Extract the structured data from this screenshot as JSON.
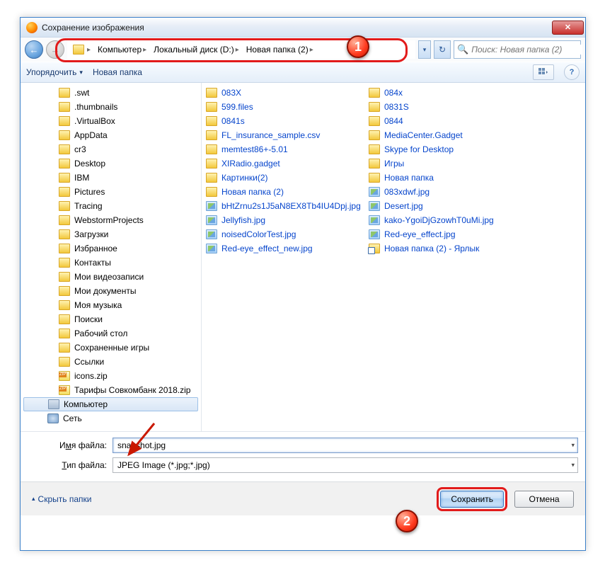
{
  "window": {
    "title": "Сохранение изображения"
  },
  "nav": {
    "breadcrumb": [
      "Компьютер",
      "Локальный диск (D:)",
      "Новая папка (2)"
    ],
    "search_placeholder": "Поиск: Новая папка (2)"
  },
  "toolbar": {
    "organize": "Упорядочить",
    "new_folder": "Новая папка"
  },
  "tree": [
    {
      "label": ".swt",
      "icon": "fld"
    },
    {
      "label": ".thumbnails",
      "icon": "fld"
    },
    {
      "label": ".VirtualBox",
      "icon": "fld"
    },
    {
      "label": "AppData",
      "icon": "fld"
    },
    {
      "label": "cr3",
      "icon": "fld"
    },
    {
      "label": "Desktop",
      "icon": "fld"
    },
    {
      "label": "IBM",
      "icon": "fld"
    },
    {
      "label": "Pictures",
      "icon": "fld"
    },
    {
      "label": "Tracing",
      "icon": "fld"
    },
    {
      "label": "WebstormProjects",
      "icon": "fld"
    },
    {
      "label": "Загрузки",
      "icon": "fld"
    },
    {
      "label": "Избранное",
      "icon": "fld"
    },
    {
      "label": "Контакты",
      "icon": "fld"
    },
    {
      "label": "Мои видеозаписи",
      "icon": "fld"
    },
    {
      "label": "Мои документы",
      "icon": "fld"
    },
    {
      "label": "Моя музыка",
      "icon": "fld"
    },
    {
      "label": "Поиски",
      "icon": "fld"
    },
    {
      "label": "Рабочий стол",
      "icon": "fld"
    },
    {
      "label": "Сохраненные игры",
      "icon": "fld"
    },
    {
      "label": "Ссылки",
      "icon": "fld"
    },
    {
      "label": "icons.zip",
      "icon": "zip"
    },
    {
      "label": "Тарифы Совкомбанк 2018.zip",
      "icon": "zip"
    },
    {
      "label": "Компьютер",
      "icon": "cmp",
      "l1": true,
      "sel": true
    },
    {
      "label": "Сеть",
      "icon": "net",
      "l1": true
    }
  ],
  "files_col1": [
    {
      "label": "083X",
      "icon": "fld"
    },
    {
      "label": "599.files",
      "icon": "fld"
    },
    {
      "label": "0841s",
      "icon": "fld"
    },
    {
      "label": "FL_insurance_sample.csv",
      "icon": "fld"
    },
    {
      "label": "memtest86+-5.01",
      "icon": "fld"
    },
    {
      "label": "XIRadio.gadget",
      "icon": "fld"
    },
    {
      "label": "Картинки(2)",
      "icon": "fld"
    },
    {
      "label": "Новая папка (2)",
      "icon": "fld"
    },
    {
      "label": "bHtZrnu2s1J5aN8EX8Tb4IU4Dpj.jpg",
      "icon": "img"
    },
    {
      "label": "Jellyfish.jpg",
      "icon": "img"
    },
    {
      "label": "noisedColorTest.jpg",
      "icon": "img"
    },
    {
      "label": "Red-eye_effect_new.jpg",
      "icon": "img"
    }
  ],
  "files_col2": [
    {
      "label": "084x",
      "icon": "fld"
    },
    {
      "label": "0831S",
      "icon": "fld"
    },
    {
      "label": "0844",
      "icon": "fld"
    },
    {
      "label": "MediaCenter.Gadget",
      "icon": "fld"
    },
    {
      "label": "Skype for Desktop",
      "icon": "fld"
    },
    {
      "label": "Игры",
      "icon": "fld"
    },
    {
      "label": "Новая папка",
      "icon": "fld"
    },
    {
      "label": "083xdwf.jpg",
      "icon": "img"
    },
    {
      "label": "Desert.jpg",
      "icon": "img"
    },
    {
      "label": "kako-YgoiDjGzowhT0uMi.jpg",
      "icon": "img"
    },
    {
      "label": "Red-eye_effect.jpg",
      "icon": "img"
    },
    {
      "label": "Новая папка (2) - Ярлык",
      "icon": "lnk"
    }
  ],
  "form": {
    "filename_label_pre": "И",
    "filename_label_u": "м",
    "filename_label_post": "я файла:",
    "filename_value": "snapshot.jpg",
    "type_label_pre": "",
    "type_label_u": "Т",
    "type_label_post": "ип файла:",
    "type_value": "JPEG Image (*.jpg;*.jpg)"
  },
  "buttons": {
    "hide_folders": "Скрыть папки",
    "save": "Сохранить",
    "cancel": "Отмена"
  },
  "markers": {
    "m1": "1",
    "m2": "2"
  }
}
